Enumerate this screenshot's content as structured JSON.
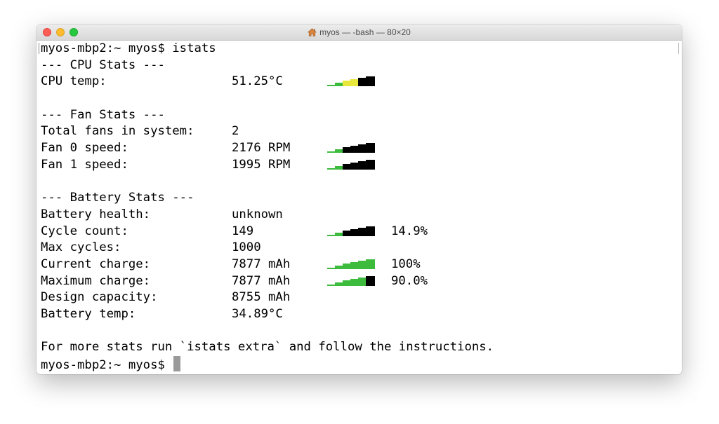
{
  "window": {
    "title": "myos — -bash — 80×20",
    "title_icon": "home-icon"
  },
  "colors": {
    "green": "#3cbb3c",
    "yellow": "#e8e83c",
    "black": "#000000",
    "cursor": "#9a9a9a"
  },
  "terminal": {
    "prompt_command": "myos-mbp2:~ myos$ istats",
    "cpu_header": "--- CPU Stats ---",
    "cpu_temp_label": "CPU temp:",
    "cpu_temp_value": "51.25°C",
    "fan_header": "--- Fan Stats ---",
    "fans_total_label": "Total fans in system:",
    "fans_total_value": "2",
    "fan0_label": "Fan 0 speed:",
    "fan0_value": "2176 RPM",
    "fan1_label": "Fan 1 speed:",
    "fan1_value": "1995 RPM",
    "battery_header": "--- Battery Stats ---",
    "battery_health_label": "Battery health:",
    "battery_health_value": "unknown",
    "cycle_count_label": "Cycle count:",
    "cycle_count_value": "149",
    "cycle_count_percent": "14.9%",
    "max_cycles_label": "Max cycles:",
    "max_cycles_value": "1000",
    "current_charge_label": "Current charge:",
    "current_charge_value": "7877 mAh",
    "current_charge_percent": "100%",
    "maximum_charge_label": "Maximum charge:",
    "maximum_charge_value": "7877 mAh",
    "maximum_charge_percent": "90.0%",
    "design_capacity_label": "Design capacity:",
    "design_capacity_value": "8755 mAh",
    "battery_temp_label": "Battery temp:",
    "battery_temp_value": "34.89°C",
    "footer_message": "For more stats run `istats extra` and follow the instructions.",
    "final_prompt": "myos-mbp2:~ myos$"
  },
  "bars": {
    "cpu": [
      "green",
      "green",
      "yellow",
      "yellow",
      "black",
      "black"
    ],
    "fan0": [
      "green",
      "green",
      "black",
      "black",
      "black",
      "black"
    ],
    "fan1": [
      "green",
      "green",
      "black",
      "black",
      "black",
      "black"
    ],
    "cycle": [
      "green",
      "green",
      "black",
      "black",
      "black",
      "black"
    ],
    "current": [
      "green",
      "green",
      "green",
      "green",
      "green",
      "green"
    ],
    "maximum": [
      "green",
      "green",
      "green",
      "green",
      "green",
      "black"
    ]
  }
}
